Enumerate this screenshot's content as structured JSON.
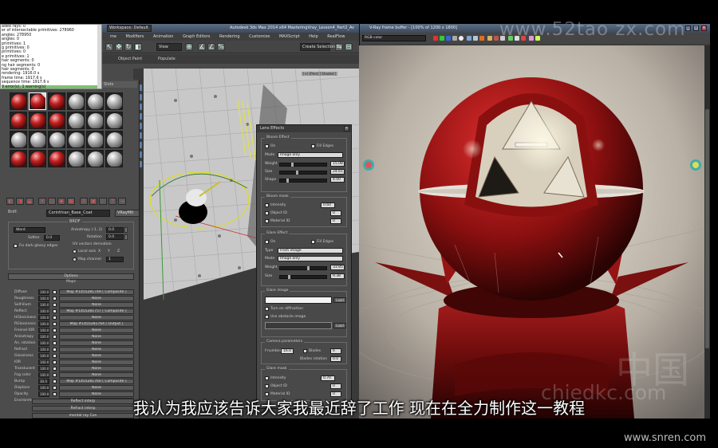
{
  "app": {
    "title": "Autodesk 3ds Max 2014 x64     MasteringVray_Lesson4_Part2_Av",
    "workspace": "Workspace: Default"
  },
  "menu": [
    "me",
    "Modifiers",
    "Animation",
    "Graph Editors",
    "Rendering",
    "Customize",
    "MAXScript",
    "Help",
    "RealFlow"
  ],
  "toolbar": {
    "view_label": "View",
    "selection_set": "Create Selection Se"
  },
  "ribbon": {
    "object_paint": "Object Paint",
    "populate": "Populate"
  },
  "viewport": {
    "label": "[+] [Pers] [ Shaded ]"
  },
  "stats_lines": [
    "aded rays: 0",
    "er of intersectable primitives: 278960",
    "angles: 278950",
    "angles: 0",
    "primitives: 1",
    "g primitives: 0",
    "primitives: 0",
    "e primitives: 1",
    "hair segments: 0",
    "ng hair segments: 0",
    "hair segments: 0",
    "rendering: 1916.0 s",
    "frame time: 1917.6 s",
    "sequence time: 1917.6 s",
    "0 error(s), 1 warning(s)"
  ],
  "material_editor": {
    "title": "Slots",
    "name_label": "Brdf:",
    "material_name": "Corinthian_Base_Coat",
    "material_type": "VRayMtl",
    "brdf_title": "BRDF",
    "brdf_type": "Ward",
    "soften_label": "Soften",
    "soften_value": "0.0",
    "fix_dark_label": "Fix dark glossy edges",
    "anisotropy_label": "Anisotropy (-1..1)",
    "anisotropy_value": "0.0",
    "rotation_label": "Rotation",
    "rotation_value": "0.0",
    "uv_label": "UV vectors derivation",
    "local_axis_label": "Local axis",
    "axis_x": "X",
    "axis_y": "Y",
    "axis_z": "Z",
    "map_channel_label": "Map channel",
    "map_channel_value": "1",
    "options_label": "Options",
    "maps_label": "Maps",
    "maps": [
      {
        "name": "Diffuse",
        "value": "100.0",
        "map": "Map #1455281749  ( Composite )"
      },
      {
        "name": "Roughness",
        "value": "100.0",
        "map": "None"
      },
      {
        "name": "Self-illum",
        "value": "100.0",
        "map": "None"
      },
      {
        "name": "Reflect",
        "value": "100.0",
        "map": "Map #1455281757  ( Composite )"
      },
      {
        "name": "HGlossiness",
        "value": "100.0",
        "map": "None"
      },
      {
        "name": "RGlossiness",
        "value": "100.0",
        "map": "Map #1455281764  ( Output )"
      },
      {
        "name": "Fresnel IOR",
        "value": "100.0",
        "map": "None"
      },
      {
        "name": "Anisotropy",
        "value": "100.0",
        "map": "None"
      },
      {
        "name": "An. rotation",
        "value": "100.0",
        "map": "None"
      },
      {
        "name": "Refract",
        "value": "100.0",
        "map": "None"
      },
      {
        "name": "Glossiness",
        "value": "100.0",
        "map": "None"
      },
      {
        "name": "IOR",
        "value": "100.0",
        "map": "None"
      },
      {
        "name": "Translucent",
        "value": "100.0",
        "map": "None"
      },
      {
        "name": "Fog color",
        "value": "100.0",
        "map": "None"
      },
      {
        "name": "Bump",
        "value": "30.0",
        "map": "Map #1455281760  ( Composite )"
      },
      {
        "name": "Displace",
        "value": "100.0",
        "map": "None"
      },
      {
        "name": "Opacity",
        "value": "100.0",
        "map": "None"
      },
      {
        "name": "Environment",
        "value": "",
        "map": "None"
      }
    ],
    "bottom_rows": [
      "Reflect interp",
      "Refract interp",
      "mental ray Con"
    ]
  },
  "lens_effects": {
    "title": "Lens Effects",
    "bloom_group": "Bloom Effect",
    "on_label": "On",
    "fill_edges_label": "Fill Edges",
    "mode_label": "Mode",
    "bloom_mode": "Image only",
    "weight_label": "Weight",
    "bloom_weight": "15.08",
    "size_label": "Size",
    "bloom_size": "24.61",
    "shape_label": "Shape",
    "bloom_shape": "4.00",
    "mask_group": "Bloom mask",
    "intensity_label": "Intensity",
    "bloom_intensity": "0.60",
    "object_id_label": "Object ID",
    "object_id_value": "0",
    "material_id_label": "Material ID",
    "material_id_value": "0",
    "glare_group": "Glare Effect",
    "type_label": "Type",
    "glare_type": "From image",
    "glare_mode": "Image only",
    "glare_weight": "33.85",
    "glare_size": "9.38",
    "glare_image_group": "Glare image",
    "load_label": "Load",
    "turn_on_diffraction": "Turn on diffraction",
    "use_obstacle": "Use obstacle image",
    "camera_group": "Camera parameters",
    "f_number_label": "f-number",
    "f_number_value": "16.0",
    "blades_label": "Blades",
    "blades_value": "6",
    "blades_rotation_label": "Blades rotation",
    "blades_rotation_value": "0.0",
    "glare_mask_group": "Glare mask",
    "glare_intensity": "0.70",
    "glare_object_id": "0",
    "glare_material_id": "0"
  },
  "vfb": {
    "title": "V-Ray frame buffer - [100% of 1200 x 1800]",
    "channel": "RGB color"
  },
  "subtitle": "我认为我应该告诉大家我最近辞了工作  现在在全力制作这一教程",
  "watermarks": {
    "top": "www.52tao zx.com",
    "mid": "chiedkc.com",
    "cn": "中国",
    "bottom": "www.snren.com"
  },
  "colors": {
    "accent": "#c02020",
    "ui_bg": "#4a4a4a",
    "title_blue": "#5c6e84"
  }
}
